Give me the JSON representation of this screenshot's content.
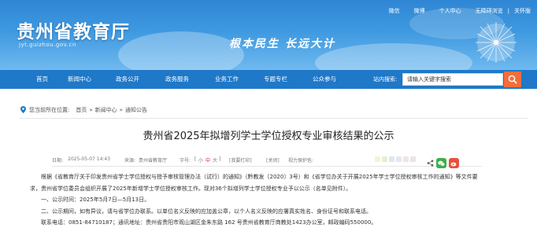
{
  "header": {
    "site_title": "贵州省教育厅",
    "site_domain": "jyt.guizhou.gov.cn",
    "slogan": "根本民生  长远大计",
    "toplinks": [
      "微信",
      "微博",
      "个人中心",
      "无障碍浏览",
      "关怀版"
    ]
  },
  "nav": {
    "items": [
      "首页",
      "新闻中心",
      "政务公开",
      "政务服务",
      "业务工作",
      "专题专栏",
      "公众参与"
    ],
    "search_label": "站内搜索:",
    "search_placeholder": "请输入关键字搜索"
  },
  "breadcrumb": {
    "prefix": "您当前所在位置:",
    "items": [
      "首页",
      "新闻中心",
      "通知公告"
    ],
    "sep": "»"
  },
  "article": {
    "title": "贵州省2025年拟增列学士学位授权专业审核结果的公示",
    "date_label": "日期:",
    "date": "2025-05-07 14:43",
    "source_label": "来源:",
    "source": "贵州省教育厅",
    "font_label": "字号:",
    "font_small": "小",
    "font_mid": "中",
    "font_large": "大",
    "print": "[我要打印]",
    "close": "[关闭]",
    "eye_label": "视力保护色:",
    "eye_colors": [
      "#f6f3cf",
      "#e4eeda",
      "#d9e9f2",
      "#ebe3f3",
      "#f2e3e3",
      "#e6e6e6"
    ],
    "paragraphs": [
      "根据《省教育厅关于印发贵州省学士学位授权与授予审核管理办法（试行）的通知》（黔教发〔2020〕3号）和《省学位办关于开展2025年学士学位授权审核工作的通知》等文件要",
      "求，贵州省学位委员会组织开展了2025年新增学士学位授权审核工作。现对36个拟增列学士学位授权专业予以公示（名单见附件）。",
      "一、公示时间：2025年5月7日—5月13日。",
      "二、公示期间，如有异议，请与省学位办联系。以单位名义反映的应加盖公章，以个人名义反映的应署真实姓名、身份证号和联系电话。",
      "联系电话：0851-84710187；通讯地址：贵州省贵阳市观山湖区金朱东路 162 号贵州省教育厅商教处1423办公室，邮政编码550000。"
    ]
  }
}
